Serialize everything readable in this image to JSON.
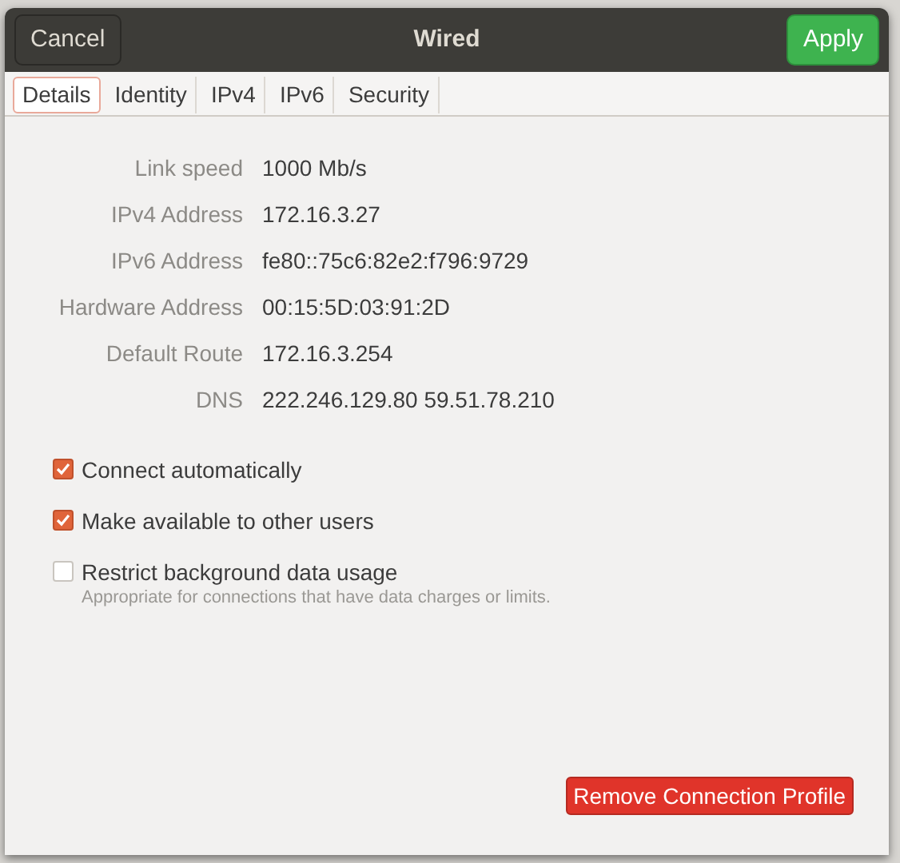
{
  "window": {
    "title": "Wired"
  },
  "header_buttons": [
    {
      "label": "Cancel",
      "kind": "cancel"
    },
    {
      "label": "Apply",
      "kind": "apply"
    }
  ],
  "tabs": [
    {
      "label": "Details",
      "selected": true
    },
    {
      "label": "Identity",
      "selected": false
    },
    {
      "label": "IPv4",
      "selected": false
    },
    {
      "label": "IPv6",
      "selected": false
    },
    {
      "label": "Security",
      "selected": false
    }
  ],
  "details": [
    {
      "label": "Link speed",
      "value": "1000 Mb/s"
    },
    {
      "label": "IPv4 Address",
      "value": "172.16.3.27"
    },
    {
      "label": "IPv6 Address",
      "value": "fe80::75c6:82e2:f796:9729"
    },
    {
      "label": "Hardware Address",
      "value": "00:15:5D:03:91:2D"
    },
    {
      "label": "Default Route",
      "value": "172.16.3.254"
    },
    {
      "label": "DNS",
      "value": "222.246.129.80 59.51.78.210"
    }
  ],
  "options": [
    {
      "label": "Connect automatically",
      "checked": true
    },
    {
      "label": "Make available to other users",
      "checked": true
    },
    {
      "label": "Restrict background data usage",
      "checked": false,
      "hint": "Appropriate for connections that have data charges or limits."
    }
  ],
  "remove_button": {
    "label": "Remove Connection Profile"
  }
}
